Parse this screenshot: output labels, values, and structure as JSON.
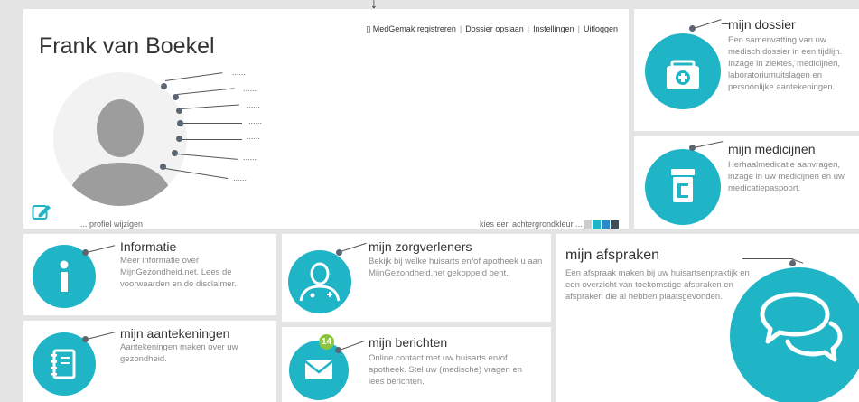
{
  "top_arrow": "↓",
  "profile": {
    "name": "Frank van Boekel",
    "menu": [
      {
        "label": "▯ MedGemak registreren"
      },
      {
        "label": "Dossier opslaan"
      },
      {
        "label": "Instellingen"
      },
      {
        "label": "Uitloggen"
      }
    ],
    "field_placeholder": "......",
    "edit_label": "... profiel wijzigen",
    "bg_label": "kies een achtergrondkleur ...",
    "swatches": [
      "#cccccc",
      "#1fb4c6",
      "#2a89c9",
      "#3f4d57"
    ]
  },
  "tiles": {
    "dossier": {
      "title": "mijn dossier",
      "desc": "Een samenvatting van uw medisch dossier in een tijdlijn. Inzage in ziektes, medicijnen, laboratoriumuitslagen en persoonlijke aantekeningen."
    },
    "medicijnen": {
      "title": "mijn medicijnen",
      "desc": "Herhaalmedicatie aanvragen, inzage in uw medicijnen en uw medicatiepaspoort."
    },
    "informatie": {
      "title": "Informatie",
      "desc": "Meer informatie over MijnGezondheid.net. Lees de voorwaarden en de disclaimer."
    },
    "zorgverleners": {
      "title": "mijn zorgverleners",
      "desc": "Bekijk bij welke huisarts en/of apotheek u aan MijnGezondheid.net gekoppeld bent."
    },
    "afspraken": {
      "title": "mijn afspraken",
      "desc": "Een afspraak maken bij uw huisartsenpraktijk en een overzicht van toekomstige afspraken en afspraken die al hebben plaatsgevonden."
    },
    "aantekeningen": {
      "title": "mijn aantekeningen",
      "desc": "Aantekeningen maken over uw gezondheid."
    },
    "berichten": {
      "title": "mijn berichten",
      "desc": "Online contact met uw huisarts en/of apotheek. Stel uw (medische) vragen en lees berichten.",
      "badge": "14"
    }
  }
}
